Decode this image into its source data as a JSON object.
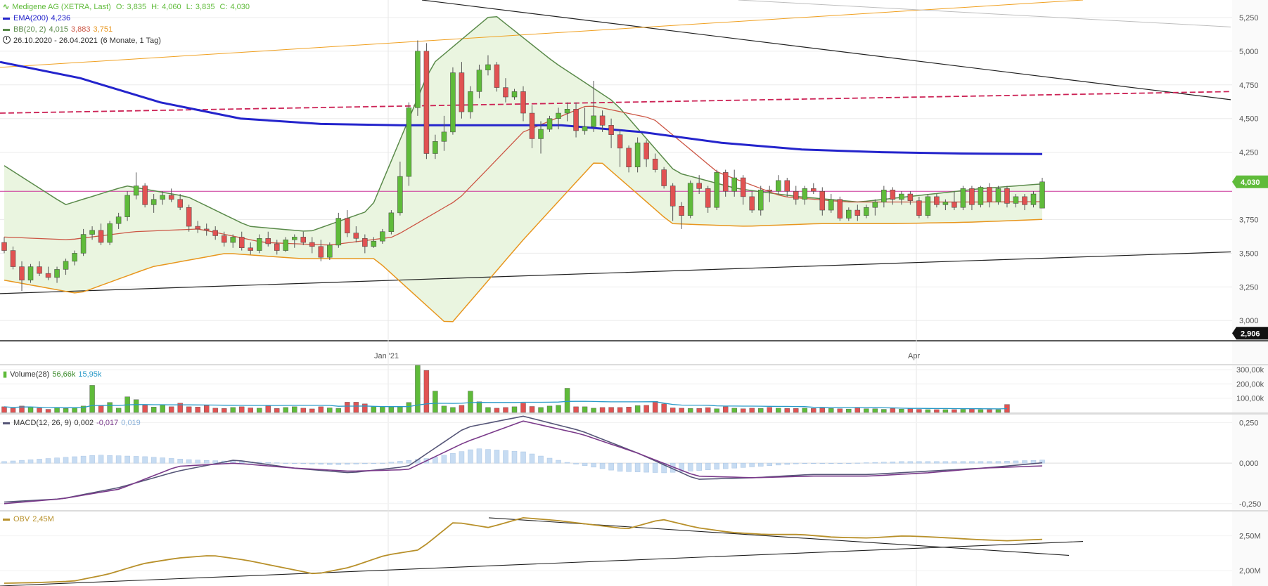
{
  "header": {
    "instrument": "Medigene AG (XETRA, Last)",
    "ohlc": {
      "o_label": "O:",
      "o": "3,835",
      "h_label": "H:",
      "h": "4,060",
      "l_label": "L:",
      "l": "3,835",
      "c_label": "C:",
      "c": "4,030"
    },
    "ema_label": "EMA(200)",
    "ema_value": "4,236",
    "bb_label": "BB(20, 2)",
    "bb_upper": "4,015",
    "bb_mid": "3,883",
    "bb_lower": "3,751",
    "range": "26.10.2020 - 26.04.2021",
    "range_note": "(6 Monate, 1 Tag)"
  },
  "price_axis": {
    "ticks": [
      "5,250",
      "5,000",
      "4,750",
      "4,500",
      "4,250",
      "3,750",
      "3,500",
      "3,250",
      "3,000"
    ],
    "tick_values": [
      5.25,
      5.0,
      4.75,
      4.5,
      4.25,
      3.75,
      3.5,
      3.25,
      3.0
    ],
    "last_tag": "4,030",
    "low_tag": "2,906",
    "range": [
      2.85,
      5.38
    ]
  },
  "time_axis": {
    "labels": [
      "Jan '21",
      "Apr"
    ]
  },
  "volume": {
    "label": "Volume(28)",
    "v1": "56,66k",
    "v2": "15,95k",
    "ticks": [
      "300,00k",
      "200,00k",
      "100,00k"
    ],
    "tick_values": [
      300,
      200,
      100
    ],
    "range": [
      0,
      330
    ]
  },
  "macd": {
    "label": "MACD(12, 26, 9)",
    "v1": "0,002",
    "v2": "-0,017",
    "v3": "0,019",
    "ticks": [
      "0,250",
      "0,000",
      "-0,250"
    ],
    "tick_values": [
      0.25,
      0,
      -0.25
    ],
    "range": [
      -0.29,
      0.3
    ]
  },
  "obv": {
    "label": "OBV",
    "value": "2,45M",
    "ticks": [
      "2,50M",
      "2,00M"
    ],
    "tick_values": [
      2.5,
      2.0
    ],
    "range": [
      1.78,
      2.85
    ]
  },
  "colors": {
    "up": "#5fbb3a",
    "down": "#e15252",
    "ema": "#2424cc",
    "bb_upper": "#5a8a4a",
    "bb_mid": "#cc5544",
    "bb_lower": "#e8961e",
    "bb_fill": "#eaf5e0",
    "horizontal": "#cc3399",
    "dashed": "#cc2255",
    "obv": "#b8902a",
    "macd": "#555577",
    "signal": "#7a3a8a",
    "hist": "#c7dcf2",
    "last_tag": "#5fbb3a"
  },
  "chart_data": {
    "type": "candlestick",
    "candles": [
      [
        3.58,
        3.62,
        3.5,
        3.52
      ],
      [
        3.52,
        3.55,
        3.38,
        3.4
      ],
      [
        3.4,
        3.44,
        3.22,
        3.3
      ],
      [
        3.3,
        3.42,
        3.28,
        3.4
      ],
      [
        3.4,
        3.44,
        3.33,
        3.35
      ],
      [
        3.35,
        3.4,
        3.3,
        3.32
      ],
      [
        3.32,
        3.4,
        3.28,
        3.38
      ],
      [
        3.38,
        3.46,
        3.34,
        3.44
      ],
      [
        3.44,
        3.52,
        3.41,
        3.5
      ],
      [
        3.5,
        3.68,
        3.48,
        3.64
      ],
      [
        3.64,
        3.7,
        3.6,
        3.67
      ],
      [
        3.67,
        3.72,
        3.56,
        3.58
      ],
      [
        3.58,
        3.74,
        3.56,
        3.72
      ],
      [
        3.72,
        3.8,
        3.68,
        3.77
      ],
      [
        3.77,
        3.96,
        3.74,
        3.93
      ],
      [
        3.93,
        4.1,
        3.9,
        4.0
      ],
      [
        4.0,
        4.02,
        3.84,
        3.86
      ],
      [
        3.86,
        3.94,
        3.8,
        3.9
      ],
      [
        3.9,
        3.96,
        3.86,
        3.93
      ],
      [
        3.93,
        3.98,
        3.88,
        3.9
      ],
      [
        3.9,
        3.94,
        3.82,
        3.84
      ],
      [
        3.84,
        3.86,
        3.66,
        3.7
      ],
      [
        3.7,
        3.74,
        3.65,
        3.68
      ],
      [
        3.68,
        3.72,
        3.63,
        3.67
      ],
      [
        3.67,
        3.7,
        3.6,
        3.63
      ],
      [
        3.63,
        3.66,
        3.55,
        3.58
      ],
      [
        3.58,
        3.64,
        3.54,
        3.62
      ],
      [
        3.62,
        3.66,
        3.52,
        3.54
      ],
      [
        3.54,
        3.58,
        3.49,
        3.52
      ],
      [
        3.52,
        3.64,
        3.5,
        3.61
      ],
      [
        3.61,
        3.66,
        3.55,
        3.57
      ],
      [
        3.57,
        3.6,
        3.49,
        3.52
      ],
      [
        3.52,
        3.62,
        3.51,
        3.6
      ],
      [
        3.6,
        3.64,
        3.54,
        3.62
      ],
      [
        3.62,
        3.66,
        3.56,
        3.58
      ],
      [
        3.58,
        3.62,
        3.5,
        3.55
      ],
      [
        3.55,
        3.6,
        3.44,
        3.47
      ],
      [
        3.47,
        3.58,
        3.45,
        3.56
      ],
      [
        3.56,
        3.8,
        3.54,
        3.76
      ],
      [
        3.76,
        3.82,
        3.62,
        3.65
      ],
      [
        3.65,
        3.7,
        3.58,
        3.61
      ],
      [
        3.61,
        3.64,
        3.5,
        3.55
      ],
      [
        3.55,
        3.62,
        3.54,
        3.59
      ],
      [
        3.59,
        3.68,
        3.57,
        3.66
      ],
      [
        3.66,
        3.82,
        3.64,
        3.8
      ],
      [
        3.8,
        4.18,
        3.78,
        4.07
      ],
      [
        4.07,
        4.62,
        4.0,
        4.58
      ],
      [
        4.58,
        5.08,
        4.52,
        5.0
      ],
      [
        5.0,
        5.06,
        4.2,
        4.24
      ],
      [
        4.24,
        4.38,
        4.2,
        4.33
      ],
      [
        4.33,
        4.52,
        4.26,
        4.4
      ],
      [
        4.4,
        4.88,
        4.38,
        4.84
      ],
      [
        4.84,
        4.92,
        4.5,
        4.55
      ],
      [
        4.55,
        4.74,
        4.5,
        4.7
      ],
      [
        4.7,
        4.9,
        4.65,
        4.86
      ],
      [
        4.86,
        4.97,
        4.82,
        4.9
      ],
      [
        4.9,
        4.92,
        4.7,
        4.73
      ],
      [
        4.73,
        4.8,
        4.62,
        4.66
      ],
      [
        4.66,
        4.72,
        4.64,
        4.7
      ],
      [
        4.7,
        4.74,
        4.48,
        4.54
      ],
      [
        4.54,
        4.6,
        4.28,
        4.35
      ],
      [
        4.35,
        4.48,
        4.24,
        4.42
      ],
      [
        4.42,
        4.52,
        4.4,
        4.5
      ],
      [
        4.5,
        4.58,
        4.42,
        4.54
      ],
      [
        4.54,
        4.62,
        4.48,
        4.57
      ],
      [
        4.57,
        4.62,
        4.36,
        4.41
      ],
      [
        4.41,
        4.58,
        4.38,
        4.44
      ],
      [
        4.44,
        4.78,
        4.4,
        4.52
      ],
      [
        4.52,
        4.56,
        4.4,
        4.45
      ],
      [
        4.45,
        4.5,
        4.28,
        4.38
      ],
      [
        4.38,
        4.42,
        4.14,
        4.28
      ],
      [
        4.28,
        4.3,
        4.1,
        4.14
      ],
      [
        4.14,
        4.36,
        4.1,
        4.32
      ],
      [
        4.32,
        4.34,
        4.14,
        4.2
      ],
      [
        4.2,
        4.24,
        4.1,
        4.12
      ],
      [
        4.12,
        4.14,
        3.98,
        4.0
      ],
      [
        4.0,
        4.02,
        3.74,
        3.85
      ],
      [
        3.85,
        3.88,
        3.68,
        3.78
      ],
      [
        3.78,
        4.04,
        3.76,
        4.02
      ],
      [
        4.02,
        4.08,
        3.94,
        3.98
      ],
      [
        3.98,
        4.0,
        3.8,
        3.84
      ],
      [
        3.84,
        4.12,
        3.82,
        4.1
      ],
      [
        4.1,
        4.12,
        3.92,
        3.96
      ],
      [
        3.96,
        4.12,
        3.92,
        4.06
      ],
      [
        4.06,
        4.08,
        3.86,
        3.92
      ],
      [
        3.92,
        3.96,
        3.8,
        3.82
      ],
      [
        3.82,
        4.0,
        3.78,
        3.97
      ],
      [
        3.97,
        4.0,
        3.88,
        3.96
      ],
      [
        3.96,
        4.08,
        3.94,
        4.04
      ],
      [
        4.04,
        4.06,
        3.92,
        3.96
      ],
      [
        3.96,
        4.0,
        3.86,
        3.9
      ],
      [
        3.9,
        4.0,
        3.86,
        3.98
      ],
      [
        3.98,
        4.02,
        3.94,
        3.96
      ],
      [
        3.96,
        3.99,
        3.78,
        3.82
      ],
      [
        3.82,
        3.94,
        3.8,
        3.9
      ],
      [
        3.9,
        3.92,
        3.74,
        3.76
      ],
      [
        3.76,
        3.84,
        3.74,
        3.82
      ],
      [
        3.82,
        3.86,
        3.74,
        3.78
      ],
      [
        3.78,
        3.86,
        3.76,
        3.84
      ],
      [
        3.84,
        3.9,
        3.78,
        3.88
      ],
      [
        3.88,
        4.0,
        3.84,
        3.97
      ],
      [
        3.97,
        3.99,
        3.86,
        3.9
      ],
      [
        3.9,
        3.96,
        3.86,
        3.94
      ],
      [
        3.94,
        3.96,
        3.86,
        3.89
      ],
      [
        3.89,
        3.92,
        3.76,
        3.78
      ],
      [
        3.78,
        3.94,
        3.76,
        3.92
      ],
      [
        3.92,
        3.94,
        3.84,
        3.86
      ],
      [
        3.86,
        3.9,
        3.82,
        3.88
      ],
      [
        3.88,
        3.96,
        3.82,
        3.84
      ],
      [
        3.84,
        4.0,
        3.82,
        3.98
      ],
      [
        3.98,
        4.0,
        3.82,
        3.86
      ],
      [
        3.86,
        4.0,
        3.84,
        3.99
      ],
      [
        3.99,
        4.02,
        3.84,
        3.88
      ],
      [
        3.88,
        4.0,
        3.86,
        3.98
      ],
      [
        3.98,
        4.0,
        3.84,
        3.87
      ],
      [
        3.87,
        3.94,
        3.84,
        3.92
      ],
      [
        3.92,
        3.94,
        3.82,
        3.86
      ],
      [
        3.86,
        3.96,
        3.84,
        3.94
      ],
      [
        3.835,
        4.06,
        3.835,
        4.03
      ]
    ],
    "ema200": [
      4.92,
      4.8,
      4.62,
      4.5,
      4.46,
      4.45,
      4.45,
      4.45,
      4.4,
      4.32,
      4.27,
      4.25,
      4.24,
      4.236
    ],
    "bb_upper": [
      4.15,
      3.86,
      4.0,
      3.92,
      3.7,
      3.66,
      3.82,
      4.9,
      5.28,
      4.92,
      4.62,
      4.1,
      3.98,
      3.92,
      3.88,
      3.93,
      3.98,
      4.015
    ],
    "bb_mid": [
      3.62,
      3.6,
      3.66,
      3.68,
      3.58,
      3.56,
      3.62,
      3.9,
      4.4,
      4.6,
      4.5,
      4.1,
      3.92,
      3.88,
      3.88,
      3.88,
      3.883
    ],
    "bb_lower": [
      3.3,
      3.2,
      3.4,
      3.5,
      3.46,
      3.46,
      2.96,
      3.6,
      4.2,
      3.72,
      3.7,
      3.72,
      3.72,
      3.73,
      3.751
    ],
    "volume_k": [
      40,
      30,
      45,
      38,
      30,
      22,
      35,
      28,
      35,
      45,
      190,
      48,
      70,
      30,
      110,
      90,
      50,
      38,
      52,
      40,
      65,
      40,
      38,
      48,
      30,
      28,
      35,
      40,
      32,
      30,
      45,
      28,
      35,
      40,
      30,
      25,
      40,
      32,
      28,
      72,
      72,
      60,
      40,
      42,
      38,
      38,
      70,
      330,
      295,
      150,
      45,
      35,
      50,
      150,
      75,
      35,
      30,
      35,
      40,
      65,
      42,
      35,
      45,
      50,
      170,
      40,
      40,
      30,
      35,
      36,
      35,
      38,
      48,
      50,
      78,
      60,
      32,
      30,
      28,
      28,
      34,
      26,
      40,
      30,
      26,
      30,
      28,
      36,
      30,
      28,
      28,
      30,
      28,
      30,
      28,
      26,
      24,
      32,
      26,
      26,
      22,
      28,
      24,
      26,
      22,
      20,
      20,
      20,
      20,
      22,
      26,
      20,
      20,
      20,
      56
    ],
    "macd": [
      -0.24,
      -0.22,
      -0.15,
      -0.05,
      0.02,
      -0.03,
      -0.06,
      -0.02,
      0.22,
      0.29,
      0.2,
      0.06,
      -0.1,
      -0.09,
      -0.07,
      -0.07,
      -0.05,
      -0.03,
      0.002
    ],
    "macd_signal": [
      -0.25,
      -0.22,
      -0.16,
      -0.02,
      0.0,
      -0.03,
      -0.05,
      -0.04,
      0.13,
      0.26,
      0.18,
      0.06,
      -0.08,
      -0.09,
      -0.08,
      -0.08,
      -0.06,
      -0.03,
      -0.017
    ],
    "macd_hist": [
      0.01,
      0.03,
      0.05,
      0.04,
      0.02,
      0.01,
      0.0,
      -0.01,
      0.0,
      0.03,
      0.09,
      0.07,
      0.0,
      -0.05,
      -0.06,
      -0.04,
      -0.02,
      0.0,
      0.0,
      0.01,
      0.01,
      0.01,
      0.019
    ],
    "obv_m": [
      1.82,
      1.83,
      1.85,
      1.95,
      2.1,
      2.18,
      2.22,
      2.15,
      2.05,
      1.95,
      2.05,
      2.22,
      2.3,
      2.7,
      2.62,
      2.76,
      2.72,
      2.66,
      2.6,
      2.74,
      2.62,
      2.55,
      2.52,
      2.52,
      2.48,
      2.47,
      2.5,
      2.48,
      2.45,
      2.43,
      2.45
    ]
  }
}
